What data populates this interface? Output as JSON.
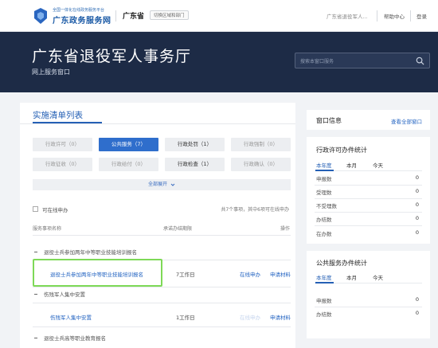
{
  "header": {
    "logo_small": "全国一体化在线政务服务平台",
    "logo_big": "广东政务服务网",
    "province": "广东省",
    "region_button": "切换区域和部门",
    "search_text": "广东省退役军人...",
    "help": "帮助中心",
    "login": "登录"
  },
  "banner": {
    "title": "广东省退役军人事务厅",
    "subtitle": "网上服务窗口",
    "search_placeholder": "搜索本窗口服务"
  },
  "main": {
    "section_title": "实施清单列表",
    "categories": [
      {
        "label": "行政许可（0）",
        "state": "disabled"
      },
      {
        "label": "公共服务（7）",
        "state": "active"
      },
      {
        "label": "行政处罚（1）",
        "state": "enabled"
      },
      {
        "label": "行政强制（0）",
        "state": "disabled"
      },
      {
        "label": "行政征收（0）",
        "state": "disabled"
      },
      {
        "label": "行政给付（0）",
        "state": "disabled"
      },
      {
        "label": "行政检查（1）",
        "state": "enabled"
      },
      {
        "label": "行政确认（0）",
        "state": "disabled"
      }
    ],
    "expand_all": "全部展开",
    "online_only": "可在线申办",
    "summary": "共7个事项，其中6项可在线申办",
    "columns": {
      "name": "服务事项名称",
      "days": "承诺办结期限",
      "action": "操作"
    },
    "groups": [
      {
        "title": "退役士兵参加两年中等职业技能培训报名",
        "items": [
          {
            "name": "退役士兵参加两年中等职业技能培训报名",
            "days": "7工作日",
            "online": "在线申办",
            "materials": "申请材料"
          }
        ]
      },
      {
        "title": "伤残军人集中安置",
        "items": [
          {
            "name": "伤残军人集中安置",
            "days": "1工作日",
            "online": "在线申办",
            "materials": "申请材料"
          }
        ]
      },
      {
        "title": "退役士兵高等职业教育报名",
        "items": []
      }
    ]
  },
  "window_info": {
    "title": "窗口信息",
    "link": "查看全部窗口"
  },
  "permit_stats": {
    "title": "行政许可办件统计",
    "tabs": [
      "本年度",
      "本月",
      "今天"
    ],
    "rows": [
      {
        "label": "申报数",
        "value": "0"
      },
      {
        "label": "受理数",
        "value": "0"
      },
      {
        "label": "不受理数",
        "value": "0"
      },
      {
        "label": "办结数",
        "value": "0"
      },
      {
        "label": "在办数",
        "value": "0"
      }
    ]
  },
  "public_stats": {
    "title": "公共服务办件统计",
    "tabs": [
      "本年度",
      "本月",
      "今天"
    ],
    "rows": [
      {
        "label": "申报数",
        "value": "0"
      },
      {
        "label": "办结数",
        "value": "0"
      }
    ]
  },
  "colors": {
    "accent": "#2560b5",
    "banner_bg": "#1d2b46",
    "active_chip": "#2f6ecc",
    "highlight_border": "#7ed957"
  }
}
